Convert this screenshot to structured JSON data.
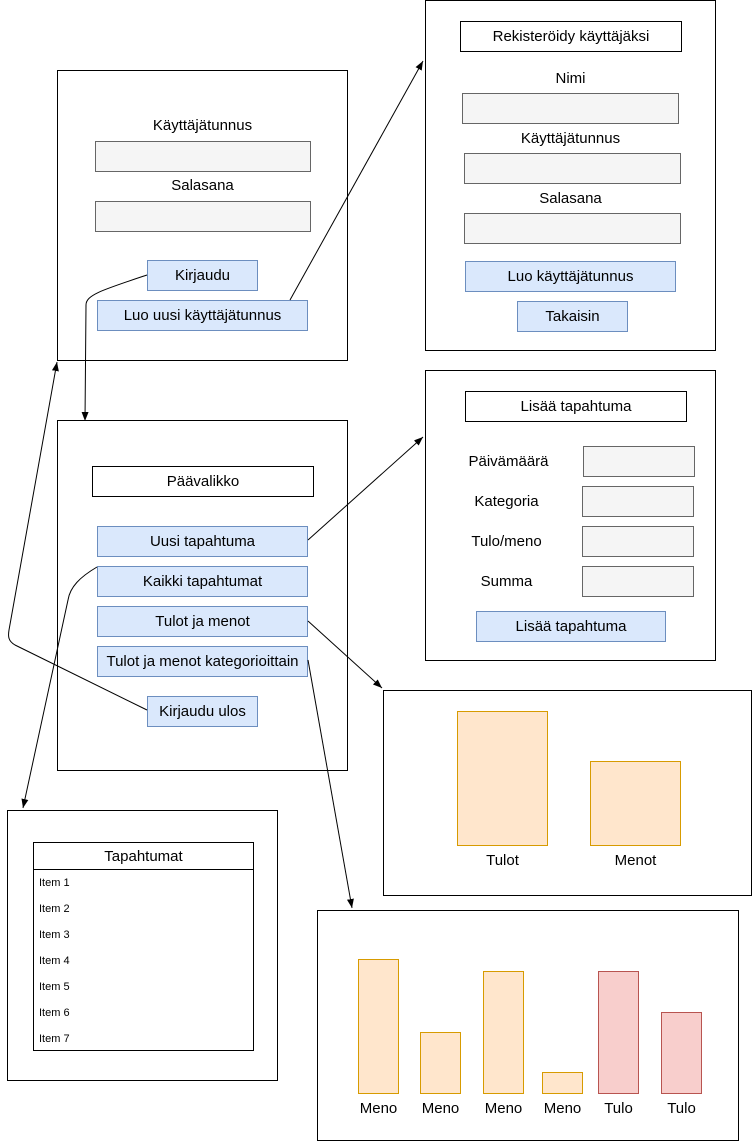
{
  "login": {
    "username_label": "Käyttäjätunnus",
    "password_label": "Salasana",
    "login_button": "Kirjaudu",
    "create_button": "Luo uusi käyttäjätunnus"
  },
  "register": {
    "title": "Rekisteröidy käyttäjäksi",
    "name_label": "Nimi",
    "username_label": "Käyttäjätunnus",
    "password_label": "Salasana",
    "create_button": "Luo käyttäjätunnus",
    "back_button": "Takaisin"
  },
  "main_menu": {
    "title": "Päävalikko",
    "new_event": "Uusi tapahtuma",
    "all_events": "Kaikki tapahtumat",
    "income_expenses": "Tulot ja menot",
    "income_expenses_by_category": "Tulot ja menot kategorioittain",
    "logout": "Kirjaudu ulos"
  },
  "add_event": {
    "title": "Lisää tapahtuma",
    "date_label": "Päivämäärä",
    "category_label": "Kategoria",
    "type_label": "Tulo/meno",
    "amount_label": "Summa",
    "submit_button": "Lisää tapahtuma"
  },
  "events_list": {
    "title": "Tapahtumat",
    "items": [
      "Item 1",
      "Item 2",
      "Item 3",
      "Item 4",
      "Item 5",
      "Item 6",
      "Item 7"
    ]
  },
  "totals_chart": {
    "labels": [
      "Tulot",
      "Menot"
    ],
    "levels": [
      1.0,
      0.63
    ]
  },
  "category_chart": {
    "labels": [
      "Meno",
      "Meno",
      "Meno",
      "Meno",
      "Tulo",
      "Tulo"
    ],
    "levels": [
      1.0,
      0.46,
      0.91,
      0.16,
      0.91,
      0.61
    ],
    "kinds": [
      "meno",
      "meno",
      "meno",
      "meno",
      "tulo",
      "tulo"
    ]
  },
  "colors": {
    "button_fill": "#dae8fc",
    "button_border": "#6c8ebf",
    "expense_fill": "#ffe6cc",
    "expense_border": "#d79b00",
    "income_fill": "#f8cecc",
    "income_border": "#b85450"
  }
}
